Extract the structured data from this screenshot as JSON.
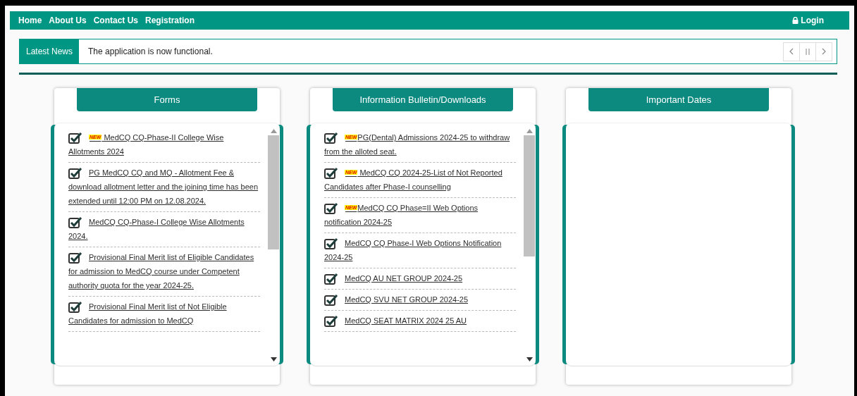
{
  "nav": {
    "links": [
      "Home",
      "About Us",
      "Contact Us",
      "Registration"
    ],
    "login": "Login"
  },
  "news": {
    "label": "Latest News",
    "text": "The application is now functional.",
    "controls": [
      {
        "kind": "prev"
      },
      {
        "kind": "pause"
      },
      {
        "kind": "next"
      }
    ]
  },
  "panels": [
    {
      "title": "Forms",
      "items": [
        {
          "badge": "NEW",
          "text": " MedCQ CQ-Phase-II College Wise Allotments 2024",
          "checked": true
        },
        {
          "text": "PG MedCQ CQ and MQ - Allotment Fee & download allotment letter and the joining time has been extended until 12:00 PM on 12.08.2024.",
          "checked": true
        },
        {
          "text": "MedCQ CQ-Phase-I College Wise Allotments 2024.",
          "checked": true
        },
        {
          "text": "Provisional Final Merit list of Eligible Candidates for admission to MedCQ course under Competent authority quota for the year 2024-25.",
          "checked": true
        },
        {
          "text": "Provisional Final Merit list of Not Eligible Candidates for admission to MedCQ",
          "checked": true
        }
      ]
    },
    {
      "title": "Information Bulletin/Downloads",
      "items": [
        {
          "badge": "NEW",
          "text": "PG(Dental) Admissions 2024-25 to withdraw from the alloted seat.",
          "checked": true
        },
        {
          "badge": "NEW",
          "text": " MedCQ CQ 2024-25-List of Not Reported Candidates after Phase-I counselling",
          "checked": true
        },
        {
          "badge": "NEW",
          "text": "MedCQ CQ Phase=II Web Options notification 2024-25",
          "checked": true
        },
        {
          "text": "MedCQ CQ Phase-I Web Options Notification 2024-25",
          "checked": true
        },
        {
          "text": "MedCQ AU NET GROUP 2024-25",
          "checked": true
        },
        {
          "text": "MedCQ SVU NET GROUP 2024-25",
          "checked": true
        },
        {
          "text": "MedCQ SEAT MATRIX 2024 25 AU",
          "checked": true
        }
      ]
    },
    {
      "title": "Important Dates"
    }
  ]
}
